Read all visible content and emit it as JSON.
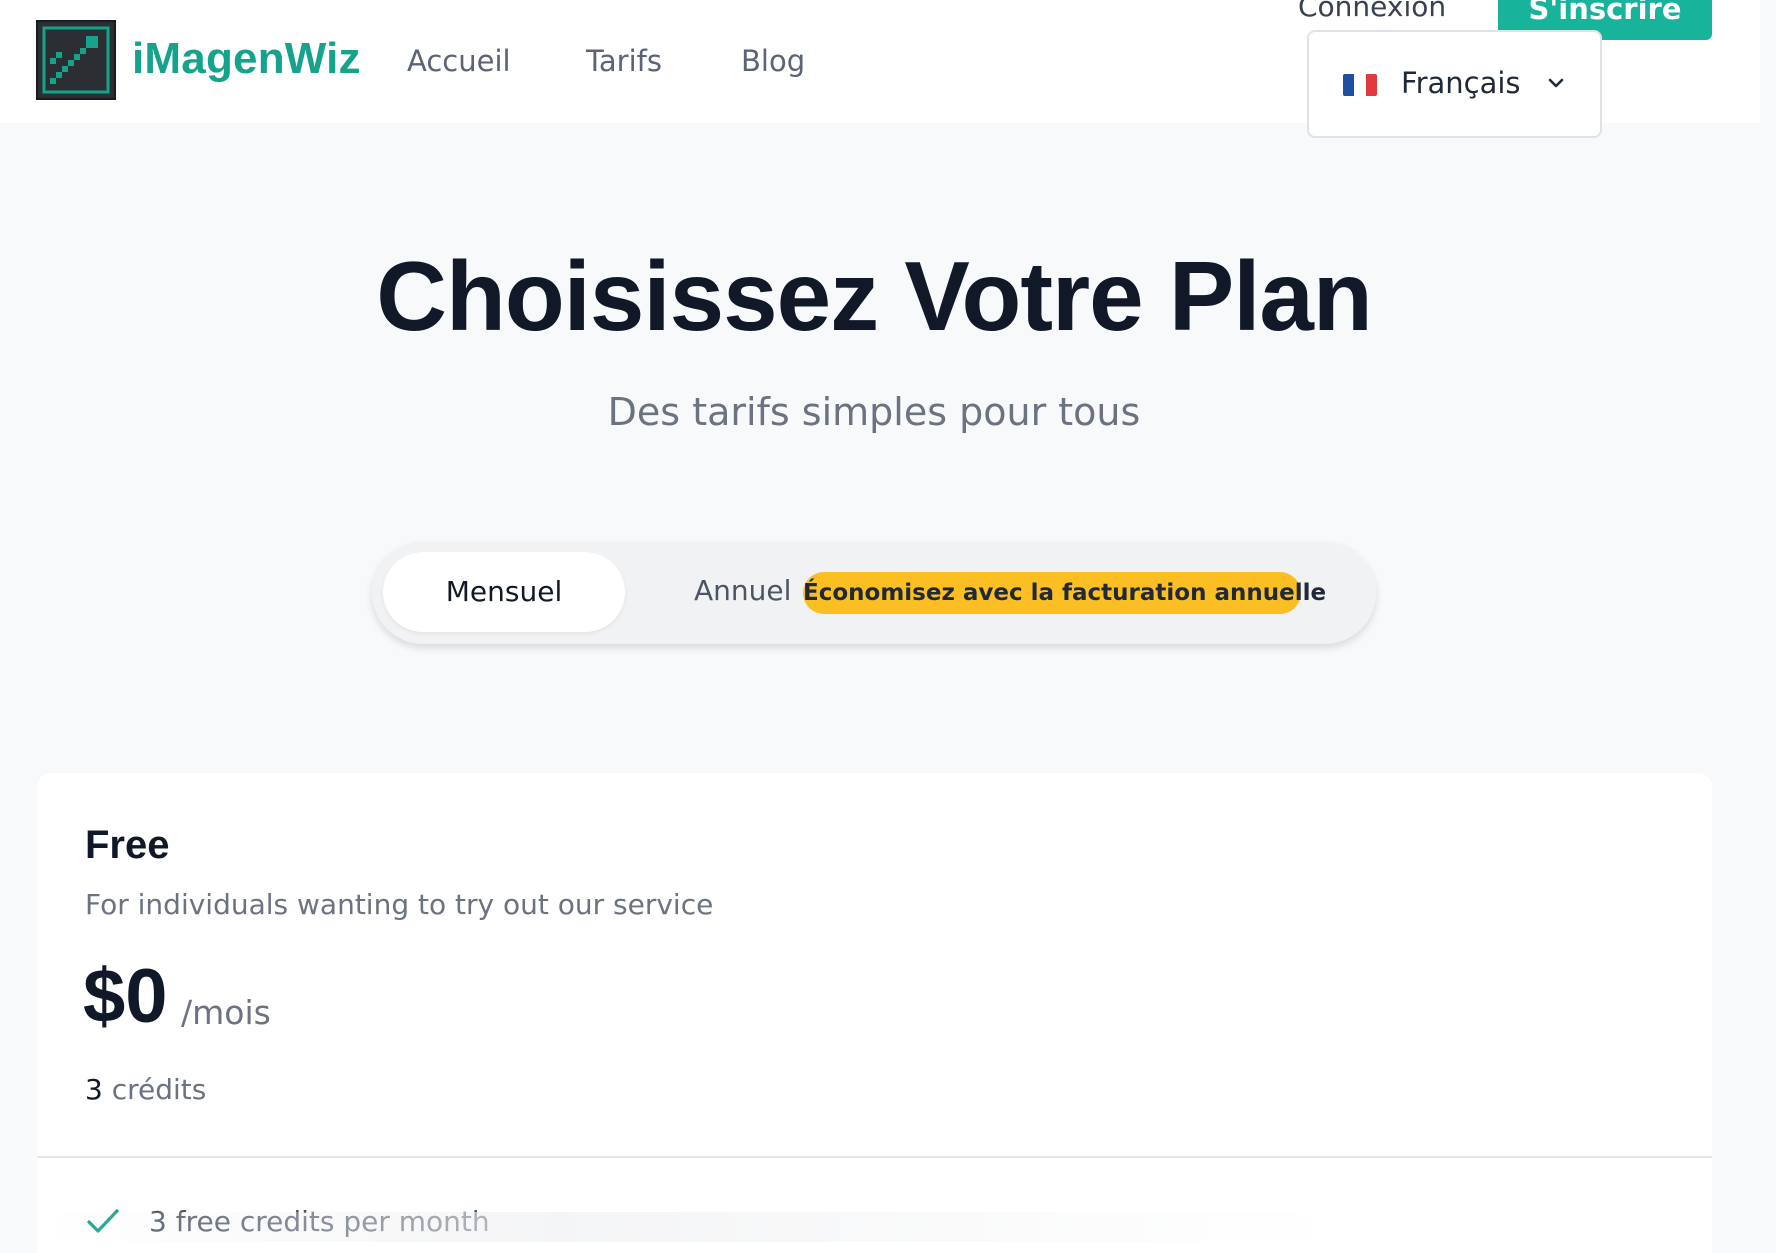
{
  "header": {
    "brand": "iMagenWiz",
    "logo_icon": "chart-arrow-logo-icon",
    "nav": [
      {
        "label": "Accueil"
      },
      {
        "label": "Tarifs"
      },
      {
        "label": "Blog"
      }
    ],
    "login_label": "Connexion",
    "signup_label": "S'inscrire",
    "language": {
      "selected": "Français",
      "flag_icon": "france-flag-icon",
      "chevron_icon": "chevron-down-icon"
    }
  },
  "hero": {
    "title": "Choisissez Votre Plan",
    "subtitle": "Des tarifs simples pour tous"
  },
  "billing_toggle": {
    "monthly_label": "Mensuel",
    "annual_label": "Annuel",
    "savings_badge": "Économisez avec la facturation annuelle",
    "selected": "Mensuel"
  },
  "plans": [
    {
      "name": "Free",
      "description": "For individuals wanting to try out our service",
      "price": "$0",
      "period": "/mois",
      "credits_count": "3",
      "credits_label": "crédits",
      "features": [
        {
          "text": "3 free credits per month",
          "icon": "check-icon"
        }
      ]
    }
  ],
  "colors": {
    "brand": "#16a38c",
    "signup": "#17b39b",
    "badge": "#fbbf24",
    "text_dark": "#111827",
    "text_muted": "#6b7280",
    "page_bg": "#f8f9fb"
  }
}
